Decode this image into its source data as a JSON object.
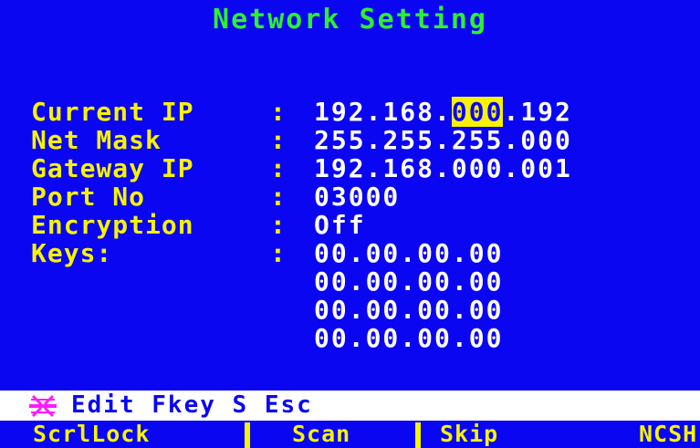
{
  "title": "Network Setting",
  "fields": [
    {
      "label": "Current IP",
      "ip": [
        "192",
        "168",
        "000",
        "192"
      ],
      "highlighted_octet": 2
    },
    {
      "label": "Net Mask",
      "value": "255.255.255.000"
    },
    {
      "label": "Gateway IP",
      "value": "192.168.000.001"
    },
    {
      "label": "Port No",
      "value": "03000"
    },
    {
      "label": "Encryption",
      "value": "Off"
    },
    {
      "label": "Keys:",
      "values": [
        "00.00.00.00",
        "00.00.00.00",
        "00.00.00.00",
        "00.00.00.00"
      ]
    }
  ],
  "separator": ":",
  "help_bar": {
    "icon": "keyboard-icon",
    "text": "Edit Fkey S Esc"
  },
  "status_bar": [
    "ScrlLock",
    "Scan",
    "Skip",
    "NCSH"
  ],
  "colors": {
    "background": "#0a06f2",
    "title": "#2ef02e",
    "label": "#f7f300",
    "value": "#ffffff",
    "highlight": "#f7f300"
  }
}
